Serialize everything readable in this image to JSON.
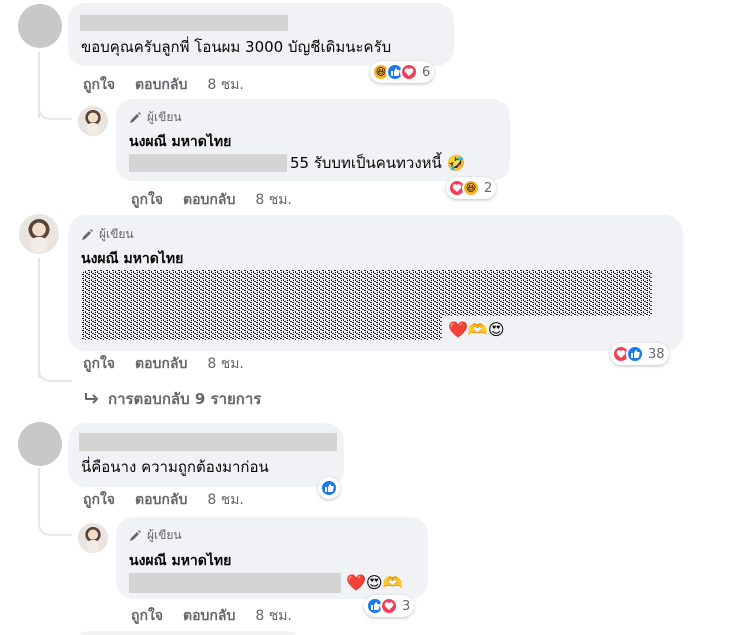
{
  "comments": [
    {
      "text": "ขอบคุณครับลูกพี่ โอนผม 3000 บัญชีเดิมนะครับ",
      "actions": {
        "like": "ถูกใจ",
        "reply": "ตอบกลับ",
        "time": "8 ชม."
      },
      "reaction_count": "6"
    },
    {
      "author_tag": "ผู้เขียน",
      "name": "นงผณี มหาดไทย",
      "text": "55 รับบทเป็นคนทวงหนี้ 🤣",
      "actions": {
        "like": "ถูกใจ",
        "reply": "ตอบกลับ",
        "time": "8 ชม."
      },
      "reaction_count": "2"
    },
    {
      "author_tag": "ผู้เขียน",
      "name": "นงผณี มหาดไทย",
      "trailing_emoji": "❤️🫶😍",
      "actions": {
        "like": "ถูกใจ",
        "reply": "ตอบกลับ",
        "time": "8 ชม."
      },
      "reaction_count": "38",
      "more_replies": "การตอบกลับ 9 รายการ"
    },
    {
      "text": "นี่คือนาง ความถูกต้องมาก่อน",
      "actions": {
        "like": "ถูกใจ",
        "reply": "ตอบกลับ",
        "time": "8 ชม."
      }
    },
    {
      "author_tag": "ผู้เขียน",
      "name": "นงผณี มหาดไทย",
      "trailing_emoji": "❤️😍🫶",
      "actions": {
        "like": "ถูกใจ",
        "reply": "ตอบกลับ",
        "time": "8 ชม."
      },
      "reaction_count": "3"
    }
  ],
  "colors": {
    "bubble": "#f0f2f5",
    "meta": "#65676b",
    "like": "#1877f2",
    "love": "#f33e58",
    "haha": "#f7b125"
  }
}
